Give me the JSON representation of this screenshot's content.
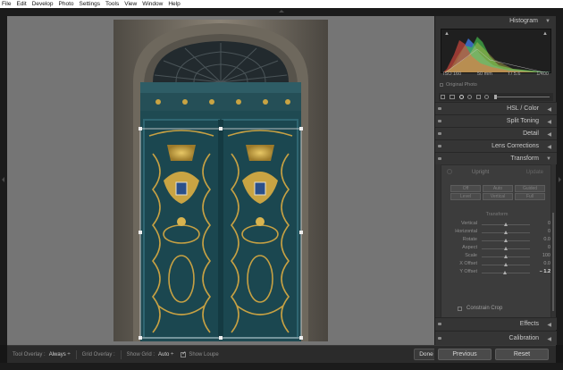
{
  "menu": [
    "File",
    "Edit",
    "Develop",
    "Photo",
    "Settings",
    "Tools",
    "View",
    "Window",
    "Help"
  ],
  "panel": {
    "histogram_title": "Histogram",
    "hist_info": {
      "iso": "ISO 160",
      "focal": "50 mm",
      "aperture": "f / 5.6",
      "shutter": "1/400"
    },
    "original_photo": "Original Photo",
    "sections": {
      "hsl": "HSL / Color",
      "split_toning": "Split Toning",
      "detail": "Detail",
      "lens_corrections": "Lens Corrections",
      "transform": "Transform",
      "effects": "Effects",
      "calibration": "Calibration"
    },
    "upright": {
      "label": "Upright",
      "update": "Update",
      "buttons": [
        "Off",
        "Auto",
        "Guided",
        "Level",
        "Vertical",
        "Full"
      ]
    },
    "transform_sub": "Transform",
    "sliders": [
      {
        "label": "Vertical",
        "value": "0",
        "pos": 0.5
      },
      {
        "label": "Horizontal",
        "value": "0",
        "pos": 0.5
      },
      {
        "label": "Rotate",
        "value": "0.0",
        "pos": 0.5
      },
      {
        "label": "Aspect",
        "value": "0",
        "pos": 0.5
      },
      {
        "label": "Scale",
        "value": "100",
        "pos": 0.5
      },
      {
        "label": "X Offset",
        "value": "0.0",
        "pos": 0.5
      },
      {
        "label": "Y Offset",
        "value": "– 1.2",
        "pos": 0.49
      }
    ],
    "constrain_crop": "Constrain Crop",
    "previous": "Previous",
    "reset": "Reset"
  },
  "toolbar": {
    "tool_overlay_label": "Tool Overlay :",
    "tool_overlay_value": "Always ÷",
    "grid_overlay_label": "Grid Overlay :",
    "show_grid_label": "Show Grid :",
    "show_grid_value": "Auto ÷",
    "show_loupe": "Show Loupe",
    "done": "Done"
  }
}
